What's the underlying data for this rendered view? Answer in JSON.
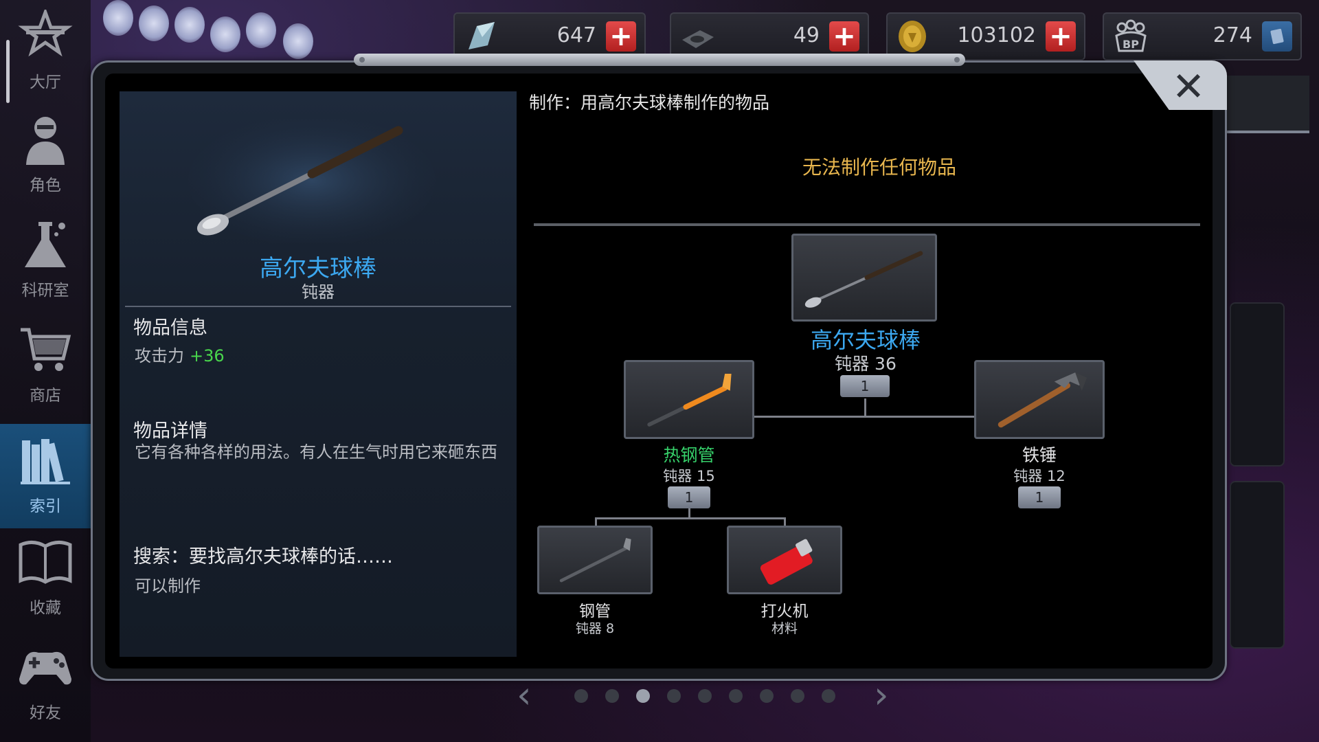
{
  "sidebar": {
    "items": [
      {
        "label": "大厅",
        "icon": "lobby-icon"
      },
      {
        "label": "角色",
        "icon": "character-icon"
      },
      {
        "label": "科研室",
        "icon": "lab-flask-icon"
      },
      {
        "label": "商店",
        "icon": "shopping-cart-icon"
      },
      {
        "label": "索引",
        "icon": "books-index-icon",
        "active": true
      },
      {
        "label": "收藏",
        "icon": "open-book-icon"
      },
      {
        "label": "好友",
        "icon": "gamepad-icon"
      }
    ]
  },
  "currencies": [
    {
      "icon": "crystal-icon",
      "amount": "647",
      "action": "+"
    },
    {
      "icon": "chip-icon",
      "amount": "49",
      "action": "+"
    },
    {
      "icon": "gold-coin-icon",
      "amount": "103102",
      "action": "+"
    },
    {
      "icon": "bp-icon",
      "amount": "274",
      "action": "card"
    }
  ],
  "modal": {
    "close_label": "✕",
    "item": {
      "name": "高尔夫球棒",
      "type": "钝器",
      "info_title": "物品信息",
      "attack_label": "攻击力",
      "attack_value": "+36",
      "details_title": "物品详情",
      "details_text": "它有各种各样的用法。有人在生气时用它来砸东西",
      "search_title": "搜索：要找高尔夫球棒的话……",
      "search_result": "可以制作"
    },
    "craft": {
      "header": "制作：用高尔夫球棒制作的物品",
      "none_message": "无法制作任何物品",
      "root": {
        "name": "高尔夫球棒",
        "stat": "钝器 36",
        "count": "1"
      },
      "children": [
        {
          "name": "热钢管",
          "stat": "钝器 15",
          "count": "1",
          "color": "#36d06a"
        },
        {
          "name": "铁锤",
          "stat": "钝器 12",
          "count": "1",
          "color": "#e2e2e4"
        }
      ],
      "grandchildren": [
        {
          "name": "钢管",
          "stat": "钝器 8"
        },
        {
          "name": "打火机",
          "stat": "材料"
        }
      ]
    }
  },
  "pager": {
    "prev": "‹",
    "next": "›",
    "total": 9,
    "current": 3
  }
}
